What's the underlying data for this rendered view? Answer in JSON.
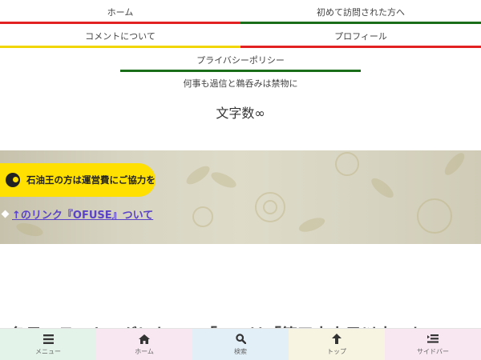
{
  "nav": {
    "row1": [
      {
        "label": "ホーム",
        "underline": "#ffffff"
      },
      {
        "label": "初めて訪問された方へ",
        "underline": "#1a6e1a"
      }
    ],
    "row2": [
      {
        "label": "コメントについて",
        "underline": "#f2d600"
      },
      {
        "label": "プロフィール",
        "underline": "#e22222"
      }
    ],
    "row3": {
      "label": "プライバシーポリシー",
      "underline": "#1a6e1a"
    },
    "row1_top_border": "#e22222"
  },
  "tagline": "何事も過信と鵜呑みは禁物に",
  "site_title": "文字数∞",
  "banner": {
    "pill_text": "石油王の方は運営費にご協力を",
    "link_text": "↑のリンク『OFUSE』ついて"
  },
  "article_peek": "各日のランキングにおいて「…」は「第三十人目以来のお」",
  "bottom_bar": [
    {
      "label": "メニュー",
      "icon": "menu-icon",
      "bg": "#e3f3e9"
    },
    {
      "label": "ホーム",
      "icon": "home-icon",
      "bg": "#f8e6f1"
    },
    {
      "label": "検索",
      "icon": "search-icon",
      "bg": "#e3eff7"
    },
    {
      "label": "トップ",
      "icon": "arrow-up-icon",
      "bg": "#f7f4e1"
    },
    {
      "label": "サイドバー",
      "icon": "sidebar-icon",
      "bg": "#f8e6f1"
    }
  ]
}
